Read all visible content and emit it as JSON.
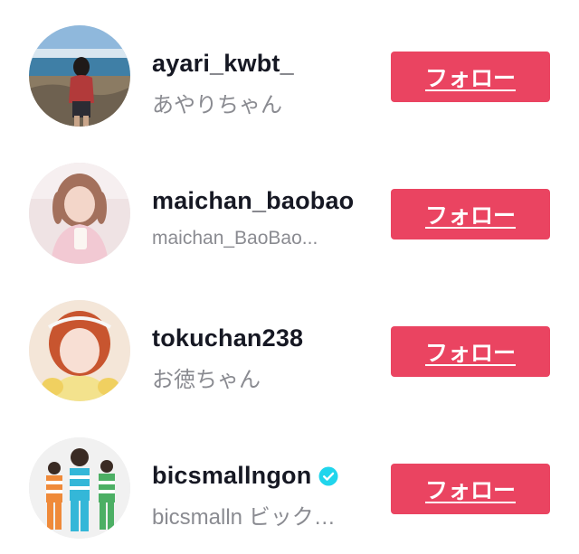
{
  "follow_list": {
    "items": [
      {
        "username": "ayari_kwbt_",
        "nickname": "あやりちゃん",
        "verified": false,
        "follow_label": "フォロー",
        "avatar_desc": "avatar-photo-beach"
      },
      {
        "username": "maichan_baobao",
        "nickname": "maichan_BaoBao...",
        "verified": false,
        "follow_label": "フォロー",
        "avatar_desc": "avatar-photo-portrait"
      },
      {
        "username": "tokuchan238",
        "nickname": "お徳ちゃん",
        "verified": false,
        "follow_label": "フォロー",
        "avatar_desc": "avatar-photo-portrait"
      },
      {
        "username": "bicsmallngon",
        "nickname": "bicsmalln ビック…",
        "verified": true,
        "verified_icon": "verified-badge-icon",
        "follow_label": "フォロー",
        "avatar_desc": "avatar-photo-group"
      }
    ]
  },
  "colors": {
    "follow_button_bg": "#ea4461",
    "follow_button_text": "#ffffff",
    "username_text": "#161823",
    "nickname_text": "#8a8b91",
    "verified_badge": "#20d5ec"
  }
}
